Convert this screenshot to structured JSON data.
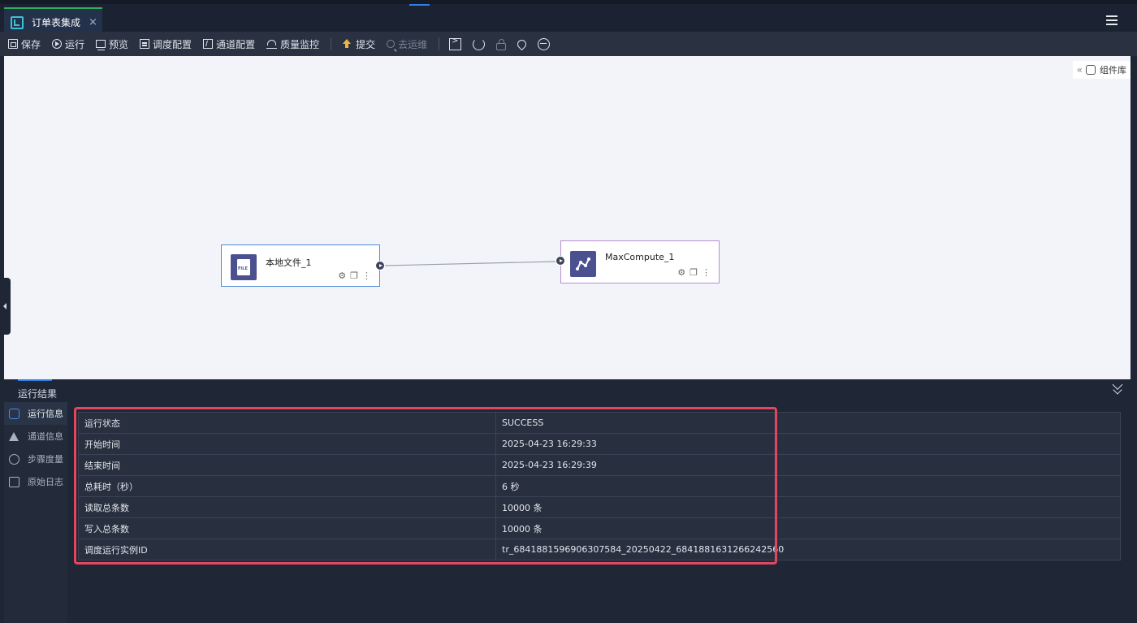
{
  "tab": {
    "title": "订单表集成",
    "close": "×"
  },
  "toolbar": {
    "save": "保存",
    "run": "运行",
    "preview": "预览",
    "schedule_config": "调度配置",
    "channel_config": "通道配置",
    "quality_monitor": "质量监控",
    "submit": "提交",
    "go_ops": "去运维"
  },
  "canvas": {
    "component_library": "组件库",
    "nodes": [
      {
        "label": "本地文件_1",
        "icon": "file-icon"
      },
      {
        "label": "MaxCompute_1",
        "icon": "maxcompute-icon"
      }
    ]
  },
  "panel": {
    "title": "运行结果",
    "menu": [
      "运行信息",
      "通道信息",
      "步骤度量",
      "原始日志"
    ],
    "rows": [
      {
        "key": "运行状态",
        "value": "SUCCESS"
      },
      {
        "key": "开始时间",
        "value": "2025-04-23 16:29:33"
      },
      {
        "key": "结束时间",
        "value": "2025-04-23 16:29:39"
      },
      {
        "key": "总耗时（秒）",
        "value": "6 秒"
      },
      {
        "key": "读取总条数",
        "value": "10000 条"
      },
      {
        "key": "写入总条数",
        "value": "10000 条"
      },
      {
        "key": "调度运行实例ID",
        "value": "tr_6841881596906307584_20250422_6841881631266242560"
      }
    ]
  },
  "colors": {
    "accent": "#2f7fe8",
    "tab_border": "#2fae5b",
    "highlight": "#e5465f",
    "node_source_border": "#4f8ad6",
    "node_target_border": "#b68fd2",
    "node_icon_bg": "#4a5090"
  }
}
